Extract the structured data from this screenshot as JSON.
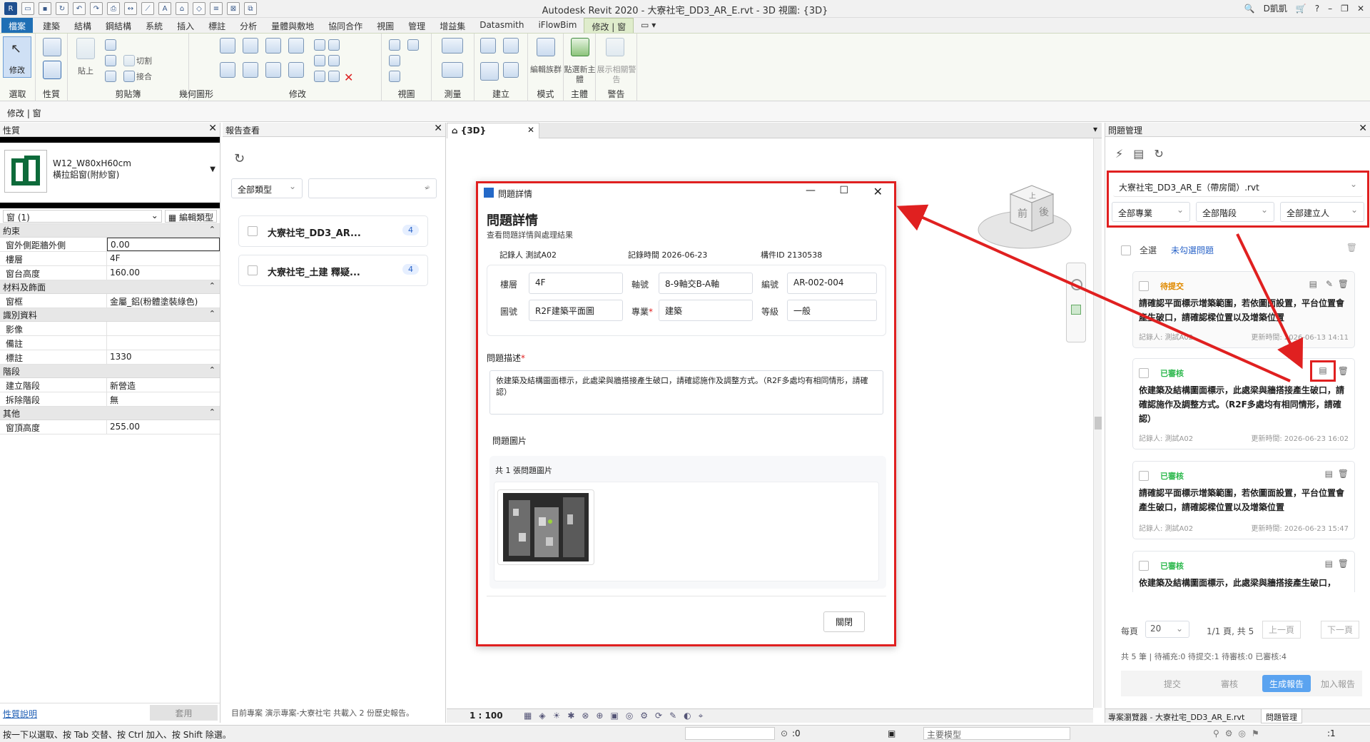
{
  "titlebar": {
    "title": "Autodesk Revit 2020 - 大寮社宅_DD3_AR_E.rvt - 3D 視圖: {3D}",
    "user": "D凱凱"
  },
  "tabs": [
    "檔案",
    "建築",
    "結構",
    "鋼結構",
    "系統",
    "插入",
    "標註",
    "分析",
    "量體與敷地",
    "協同合作",
    "視圖",
    "管理",
    "增益集",
    "Datasmith",
    "iFlowBim",
    "修改 | 窗"
  ],
  "ribbon": {
    "panels": [
      "選取",
      "性質",
      "剪貼簿",
      "幾何圖形",
      "修改",
      "視圖",
      "測量",
      "建立",
      "模式",
      "主體",
      "警告"
    ],
    "modify_label": "修改",
    "paste_label": "貼上",
    "cut_label": "切割",
    "join_label": "接合",
    "tools": [
      "編輯族群",
      "點選新主體",
      "展示相關警告"
    ]
  },
  "context": "修改 | 窗",
  "properties": {
    "title": "性質",
    "type_name": "W12_W80xH60cm",
    "type_sub": "橫拉鋁窗(附紗窗)",
    "instance": "窗 (1)",
    "edit_type": "編輯類型",
    "sections": [
      {
        "name": "約束",
        "rows": [
          [
            "窗外側距牆外側",
            "0.00"
          ],
          [
            "樓層",
            "4F"
          ],
          [
            "窗台高度",
            "160.00"
          ]
        ]
      },
      {
        "name": "材料及飾面",
        "rows": [
          [
            "窗框",
            "金屬_鋁(粉體塗裝綠色)"
          ]
        ]
      },
      {
        "name": "識別資料",
        "rows": [
          [
            "影像",
            ""
          ],
          [
            "備註",
            ""
          ],
          [
            "標註",
            "1330"
          ]
        ]
      },
      {
        "name": "階段",
        "rows": [
          [
            "建立階段",
            "新營造"
          ],
          [
            "拆除階段",
            "無"
          ]
        ]
      },
      {
        "name": "其他",
        "rows": [
          [
            "窗頂高度",
            "255.00"
          ]
        ]
      }
    ],
    "help": "性質說明",
    "apply": "套用"
  },
  "report": {
    "title": "報告查看",
    "type_filter": "全部類型",
    "items": [
      {
        "name": "大寮社宅_DD3_AR...",
        "count": "4"
      },
      {
        "name": "大寮社宅_土建 釋疑...",
        "count": "4"
      }
    ],
    "footer": "目前專案 演示專案-大寮社宅 共載入 2 份歷史報告。"
  },
  "view": {
    "tab": "{3D}",
    "scale": "1 : 100",
    "cube_top": "上",
    "cube_front": "前",
    "cube_right": "後"
  },
  "dialog": {
    "window_title": "問題詳情",
    "heading": "問題詳情",
    "subheading": "查看問題詳情與處理結果",
    "recorder_label": "記錄人",
    "recorder": "測試A02",
    "time_label": "記錄時間",
    "time": "2026-06-23",
    "id_label": "構件ID",
    "id": "2130538",
    "floor_label": "樓層",
    "floor": "4F",
    "axis_label": "軸號",
    "axis": "8-9軸交B-A軸",
    "code_label": "編號",
    "code": "AR-002-004",
    "drawing_label": "圖號",
    "drawing": "R2F建築平面圖",
    "discipline_label": "專業",
    "discipline": "建築",
    "level_label": "等級",
    "level": "一般",
    "desc_label": "問題描述",
    "desc": "依建築及結構圖面標示，此處梁與牆搭接產生破口，請確認施作及調整方式。（R2F多處均有相同情形，請確認）",
    "images_label": "問題圖片",
    "images_count": "共 1 張問題圖片",
    "close": "關閉"
  },
  "issue": {
    "title": "問題管理",
    "project": "大寮社宅_DD3_AR_E（帶房間）.rvt",
    "filters": [
      "全部專業",
      "全部階段",
      "全部建立人"
    ],
    "select_all": "全選",
    "unchecked": "未勾選問題",
    "cards": [
      {
        "status": "待提交",
        "status_color": "#e08a00",
        "text": "請確認平面標示增築範圍，若依圖面設置，平台位置會產生破口，請確認樑位置以及增築位置",
        "recorder": "記錄人: 測試A02",
        "updated": "更新時間: 2026-06-13 14:11"
      },
      {
        "status": "已審核",
        "status_color": "#2db84d",
        "text": "依建築及結構圖面標示，此處梁與牆搭接產生破口，請確認施作及調整方式。（R2F多處均有相同情形，請確認）",
        "recorder": "記錄人: 測試A02",
        "updated": "更新時間: 2026-06-23 16:02"
      },
      {
        "status": "已審核",
        "status_color": "#2db84d",
        "text": "請確認平面標示增築範圍，若依圖面設置，平台位置會產生破口，請確認樑位置以及增築位置",
        "recorder": "記錄人: 測試A02",
        "updated": "更新時間: 2026-06-23 15:47"
      },
      {
        "status": "已審核",
        "status_color": "#2db84d",
        "text": "依建築及結構圖面標示，此處梁與牆搭接產生破口，",
        "recorder": "",
        "updated": ""
      }
    ],
    "per_page_label": "每頁",
    "per_page": "20",
    "pages": "1/1 頁, 共 5",
    "prev": "上一頁",
    "next": "下一頁",
    "summary": "共 5 筆 | 待補充:0 待提交:1 待審核:0 已審核:4",
    "actions": [
      "提交",
      "審核",
      "生成報告",
      "加入報告"
    ],
    "bottom_tabs": [
      "專案瀏覽器 - 大寮社宅_DD3_AR_E.rvt",
      "問題管理"
    ]
  },
  "status": {
    "hint": "按一下以選取、按 Tab 交替、按 Ctrl 加入、按 Shift 除選。",
    "count": ":0",
    "model": "主要模型",
    "filter": ":1"
  }
}
